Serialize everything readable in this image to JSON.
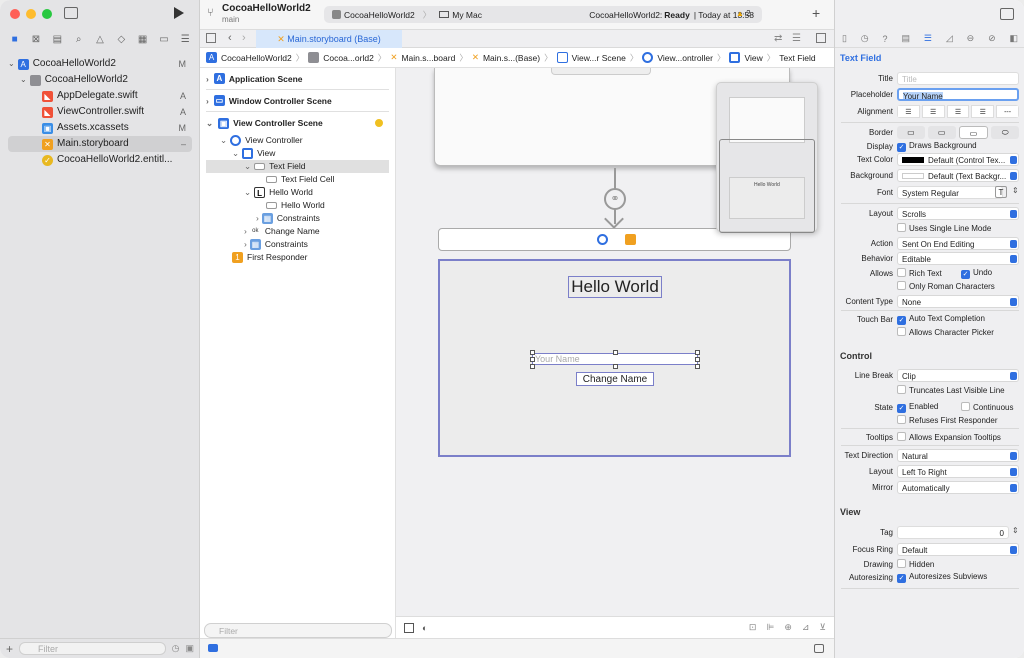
{
  "window": {
    "colors": {
      "close": "#ff5f57",
      "min": "#febc2e",
      "max": "#28c840",
      "accent": "#2f6fe0"
    }
  },
  "navigator": {
    "items": [
      {
        "label": "CocoaHelloWorld2",
        "status": "M",
        "icon": "project-icon"
      },
      {
        "label": "CocoaHelloWorld2",
        "status": "",
        "icon": "folder-icon"
      },
      {
        "label": "AppDelegate.swift",
        "status": "A",
        "icon": "swift-icon"
      },
      {
        "label": "ViewController.swift",
        "status": "A",
        "icon": "swift-icon"
      },
      {
        "label": "Assets.xcassets",
        "status": "M",
        "icon": "assets-icon"
      },
      {
        "label": "Main.storyboard",
        "status": "–",
        "icon": "storyboard-icon"
      },
      {
        "label": "CocoaHelloWorld2.entitl...",
        "status": "",
        "icon": "entitlements-icon"
      }
    ],
    "filter_placeholder": "Filter"
  },
  "toolbar": {
    "project": "CocoaHelloWorld2",
    "branch": "main",
    "scheme": "CocoaHelloWorld2",
    "destination": "My Mac",
    "status_app": "CocoaHelloWorld2:",
    "status_state": "Ready",
    "status_time": "| Today at 13:58",
    "warnings": "2"
  },
  "editor_tab": {
    "label": "Main.storyboard (Base)"
  },
  "breadcrumb": [
    "CocoaHelloWorld2",
    "Cocoa...orld2",
    "Main.s...board",
    "Main.s...(Base)",
    "View...r Scene",
    "View...ontroller",
    "View",
    "Text Field"
  ],
  "outline": {
    "scenes": [
      "Application Scene",
      "Window Controller Scene",
      "View Controller Scene"
    ],
    "items": [
      {
        "label": "View Controller",
        "level": 1
      },
      {
        "label": "View",
        "level": 2
      },
      {
        "label": "Text Field",
        "level": 3
      },
      {
        "label": "Text Field Cell",
        "level": 4
      },
      {
        "label": "Hello World",
        "level": 3
      },
      {
        "label": "Hello World",
        "level": 4
      },
      {
        "label": "Constraints",
        "level": 4
      },
      {
        "label": "Change Name",
        "level": 3
      },
      {
        "label": "Constraints",
        "level": 3
      },
      {
        "label": "First Responder",
        "level": 1
      }
    ],
    "filter_placeholder": "Filter"
  },
  "canvas": {
    "label_text": "Hello World",
    "field_placeholder": "Your Name",
    "button_label": "Change Name",
    "minimap_label": "Hello World"
  },
  "inspector": {
    "sections": {
      "text_field": "Text Field",
      "control": "Control",
      "view": "View"
    },
    "title_label": "Title",
    "title_placeholder": "Title",
    "placeholder_label": "Placeholder",
    "placeholder_value": "Your Name",
    "alignment_label": "Alignment",
    "border_label": "Border",
    "display_label": "Display",
    "display_value": "Draws Background",
    "text_color_label": "Text Color",
    "text_color_value": "Default (Control Tex...",
    "background_label": "Background",
    "background_value": "Default (Text Backgr...",
    "font_label": "Font",
    "font_value": "System Regular",
    "layout_label": "Layout",
    "layout_value": "Scrolls",
    "single_line": "Uses Single Line Mode",
    "action_label": "Action",
    "action_value": "Sent On End Editing",
    "behavior_label": "Behavior",
    "behavior_value": "Editable",
    "allows_label": "Allows",
    "rich_text": "Rich Text",
    "undo": "Undo",
    "roman_chars": "Only Roman Characters",
    "content_type_label": "Content Type",
    "content_type_value": "None",
    "touch_bar_label": "Touch Bar",
    "auto_completion": "Auto Text Completion",
    "char_picker": "Allows Character Picker",
    "line_break_label": "Line Break",
    "line_break_value": "Clip",
    "truncates": "Truncates Last Visible Line",
    "state_label": "State",
    "enabled": "Enabled",
    "continuous": "Continuous",
    "refuses": "Refuses First Responder",
    "tooltips_label": "Tooltips",
    "expansion": "Allows Expansion Tooltips",
    "text_direction_label": "Text Direction",
    "text_direction_value": "Natural",
    "control_layout_label": "Layout",
    "control_layout_value": "Left To Right",
    "mirror_label": "Mirror",
    "mirror_value": "Automatically",
    "tag_label": "Tag",
    "tag_value": "0",
    "focus_ring_label": "Focus Ring",
    "focus_ring_value": "Default",
    "drawing_label": "Drawing",
    "hidden": "Hidden",
    "autoresizing_label": "Autoresizing",
    "autoresizes": "Autoresizes Subviews"
  }
}
